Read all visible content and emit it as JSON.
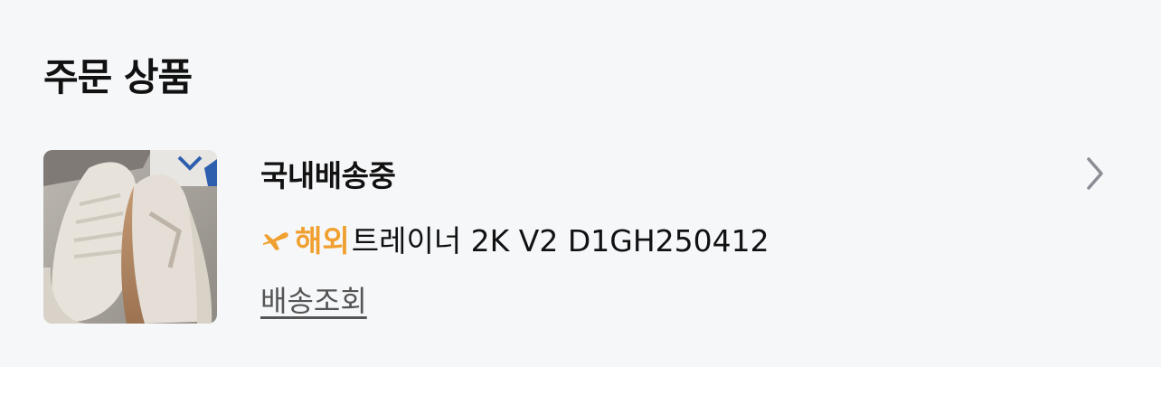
{
  "section": {
    "title": "주문 상품"
  },
  "order_item": {
    "status": "국내배송중",
    "badge_label": "해외",
    "product_name": "트레이너 2K V2 D1GH250412",
    "track_link": "배송조회",
    "thumbnail_icon": "sneaker-photo",
    "chevron_icon": "chevron-right-icon",
    "plane_icon": "airplane-icon"
  },
  "colors": {
    "background": "#f6f7f9",
    "accent_orange": "#f0a030",
    "chevron": "#8a8d93"
  }
}
